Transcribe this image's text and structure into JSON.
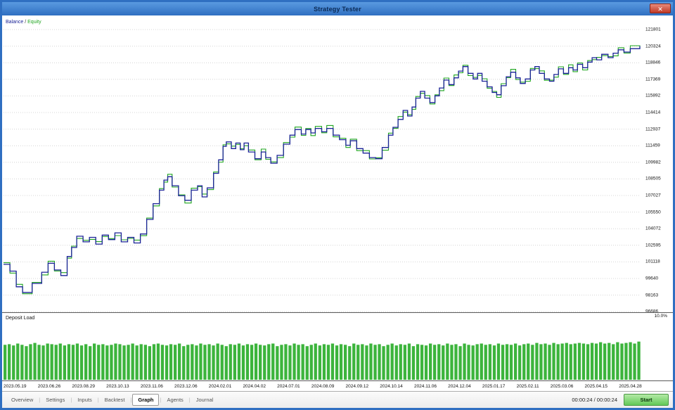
{
  "window": {
    "title": "Strategy Tester",
    "close_glyph": "✕"
  },
  "colors": {
    "balance": "#1b2397",
    "equity": "#1fa51f",
    "deposit_bar": "#3cb43c",
    "grid": "#d4d4d4",
    "titlebar": "#2f6fc1"
  },
  "chart_data": {
    "type": "line",
    "title": "Balance / Equity",
    "line_style": "step",
    "legend": [
      "Balance",
      "Equity"
    ],
    "legend_separator": " / ",
    "ylim": [
      96686,
      121801
    ],
    "y_ticks": [
      121801,
      120324,
      118846,
      117369,
      115892,
      114414,
      112937,
      111459,
      109982,
      108505,
      107027,
      105550,
      104072,
      102595,
      101118,
      99640,
      98163,
      96686
    ],
    "x_ticks": [
      "2023.05.19",
      "2023.06.26",
      "2023.08.29",
      "2023.10.13",
      "2023.11.06",
      "2023.12.06",
      "2024.02.01",
      "2024.04.02",
      "2024.07.01",
      "2024.08.09",
      "2024.09.12",
      "2024.10.14",
      "2024.11.06",
      "2024.12.04",
      "2025.01.17",
      "2025.02.11",
      "2025.03.06",
      "2025.04.15",
      "2025.04.28"
    ],
    "series": [
      {
        "name": "Balance",
        "points": [
          [
            0.0,
            100900
          ],
          [
            0.01,
            100300
          ],
          [
            0.02,
            98900
          ],
          [
            0.03,
            98400
          ],
          [
            0.045,
            99200
          ],
          [
            0.06,
            100200
          ],
          [
            0.07,
            101000
          ],
          [
            0.08,
            100400
          ],
          [
            0.09,
            99900
          ],
          [
            0.1,
            101600
          ],
          [
            0.107,
            102400
          ],
          [
            0.115,
            103400
          ],
          [
            0.125,
            102900
          ],
          [
            0.135,
            103300
          ],
          [
            0.145,
            102700
          ],
          [
            0.155,
            103500
          ],
          [
            0.165,
            103100
          ],
          [
            0.175,
            103700
          ],
          [
            0.185,
            102900
          ],
          [
            0.195,
            103300
          ],
          [
            0.205,
            102800
          ],
          [
            0.215,
            103600
          ],
          [
            0.225,
            104900
          ],
          [
            0.235,
            106300
          ],
          [
            0.245,
            107500
          ],
          [
            0.252,
            108400
          ],
          [
            0.258,
            108700
          ],
          [
            0.265,
            107900
          ],
          [
            0.275,
            107000
          ],
          [
            0.285,
            106600
          ],
          [
            0.295,
            107500
          ],
          [
            0.305,
            107900
          ],
          [
            0.312,
            106900
          ],
          [
            0.32,
            107700
          ],
          [
            0.33,
            109000
          ],
          [
            0.338,
            110200
          ],
          [
            0.345,
            111400
          ],
          [
            0.35,
            111800
          ],
          [
            0.358,
            111200
          ],
          [
            0.365,
            111700
          ],
          [
            0.372,
            111100
          ],
          [
            0.378,
            111700
          ],
          [
            0.385,
            110900
          ],
          [
            0.395,
            110300
          ],
          [
            0.405,
            110900
          ],
          [
            0.412,
            110400
          ],
          [
            0.42,
            109900
          ],
          [
            0.43,
            110600
          ],
          [
            0.44,
            111600
          ],
          [
            0.45,
            112400
          ],
          [
            0.458,
            112900
          ],
          [
            0.468,
            112500
          ],
          [
            0.475,
            112900
          ],
          [
            0.483,
            112600
          ],
          [
            0.49,
            113000
          ],
          [
            0.5,
            112700
          ],
          [
            0.508,
            113000
          ],
          [
            0.518,
            112400
          ],
          [
            0.528,
            112000
          ],
          [
            0.538,
            111500
          ],
          [
            0.545,
            111900
          ],
          [
            0.555,
            111200
          ],
          [
            0.565,
            110800
          ],
          [
            0.575,
            110400
          ],
          [
            0.585,
            110300
          ],
          [
            0.595,
            111300
          ],
          [
            0.605,
            112400
          ],
          [
            0.612,
            113100
          ],
          [
            0.62,
            113800
          ],
          [
            0.628,
            114600
          ],
          [
            0.635,
            114100
          ],
          [
            0.642,
            114900
          ],
          [
            0.648,
            115700
          ],
          [
            0.655,
            116300
          ],
          [
            0.662,
            115700
          ],
          [
            0.67,
            115300
          ],
          [
            0.678,
            115900
          ],
          [
            0.685,
            116600
          ],
          [
            0.692,
            117300
          ],
          [
            0.7,
            116900
          ],
          [
            0.708,
            117500
          ],
          [
            0.715,
            118100
          ],
          [
            0.722,
            118500
          ],
          [
            0.73,
            117900
          ],
          [
            0.738,
            117400
          ],
          [
            0.745,
            117900
          ],
          [
            0.752,
            117200
          ],
          [
            0.76,
            116700
          ],
          [
            0.768,
            116200
          ],
          [
            0.775,
            116000
          ],
          [
            0.782,
            116800
          ],
          [
            0.79,
            117600
          ],
          [
            0.797,
            118000
          ],
          [
            0.805,
            117500
          ],
          [
            0.812,
            117000
          ],
          [
            0.82,
            117400
          ],
          [
            0.828,
            118200
          ],
          [
            0.835,
            118500
          ],
          [
            0.842,
            117900
          ],
          [
            0.85,
            117400
          ],
          [
            0.858,
            117200
          ],
          [
            0.865,
            117800
          ],
          [
            0.872,
            118300
          ],
          [
            0.88,
            117900
          ],
          [
            0.888,
            118400
          ],
          [
            0.895,
            118200
          ],
          [
            0.902,
            118700
          ],
          [
            0.91,
            118400
          ],
          [
            0.918,
            118900
          ],
          [
            0.925,
            119300
          ],
          [
            0.932,
            119100
          ],
          [
            0.94,
            119600
          ],
          [
            0.95,
            119300
          ],
          [
            0.958,
            119700
          ],
          [
            0.966,
            120000
          ],
          [
            0.975,
            119800
          ],
          [
            0.985,
            120100
          ],
          [
            1.0,
            120324
          ]
        ]
      },
      {
        "name": "Equity",
        "follows": "Balance",
        "delta_pattern": [
          140,
          -180,
          220,
          -120,
          90,
          -240,
          180,
          -90,
          260,
          -150,
          120,
          -200
        ]
      }
    ]
  },
  "deposit_chart": {
    "type": "bar",
    "title": "Deposit Load",
    "axis_max_label": "10.0%",
    "ylim": [
      0,
      10
    ],
    "values": [
      5.4,
      5.5,
      5.3,
      5.6,
      5.4,
      5.2,
      5.5,
      5.7,
      5.4,
      5.3,
      5.6,
      5.5,
      5.4,
      5.6,
      5.3,
      5.5,
      5.4,
      5.6,
      5.3,
      5.5,
      5.2,
      5.6,
      5.4,
      5.5,
      5.3,
      5.4,
      5.6,
      5.5,
      5.3,
      5.4,
      5.6,
      5.3,
      5.5,
      5.4,
      5.2,
      5.5,
      5.6,
      5.4,
      5.3,
      5.5,
      5.4,
      5.6,
      5.2,
      5.4,
      5.5,
      5.3,
      5.6,
      5.4,
      5.5,
      5.3,
      5.6,
      5.4,
      5.2,
      5.5,
      5.4,
      5.6,
      5.3,
      5.5,
      5.4,
      5.6,
      5.4,
      5.3,
      5.5,
      5.6,
      5.2,
      5.4,
      5.5,
      5.3,
      5.6,
      5.4,
      5.5,
      5.2,
      5.4,
      5.6,
      5.3,
      5.5,
      5.4,
      5.6,
      5.3,
      5.5,
      5.4,
      5.2,
      5.6,
      5.4,
      5.5,
      5.3,
      5.6,
      5.4,
      5.5,
      5.2,
      5.4,
      5.6,
      5.3,
      5.5,
      5.4,
      5.6,
      5.2,
      5.5,
      5.4,
      5.3,
      5.6,
      5.4,
      5.5,
      5.3,
      5.6,
      5.4,
      5.5,
      5.2,
      5.6,
      5.4,
      5.3,
      5.5,
      5.6,
      5.4,
      5.5,
      5.3,
      5.6,
      5.4,
      5.5,
      5.4,
      5.6,
      5.3,
      5.5,
      5.6,
      5.4,
      5.7,
      5.5,
      5.6,
      5.4,
      5.7,
      5.5,
      5.6,
      5.7,
      5.5,
      5.6,
      5.7,
      5.6,
      5.5,
      5.7,
      5.6,
      5.8,
      5.6,
      5.7,
      5.5,
      5.8,
      5.6,
      5.7,
      5.8,
      5.6,
      5.9
    ]
  },
  "tabs": [
    {
      "label": "Overview",
      "selected": false
    },
    {
      "label": "Settings",
      "selected": false
    },
    {
      "label": "Inputs",
      "selected": false
    },
    {
      "label": "Backtest",
      "selected": false
    },
    {
      "label": "Graph",
      "selected": true
    },
    {
      "label": "Agents",
      "selected": false
    },
    {
      "label": "Journal",
      "selected": false
    }
  ],
  "footer": {
    "elapsed": "00:00:24 / 00:00:24",
    "start_label": "Start"
  }
}
